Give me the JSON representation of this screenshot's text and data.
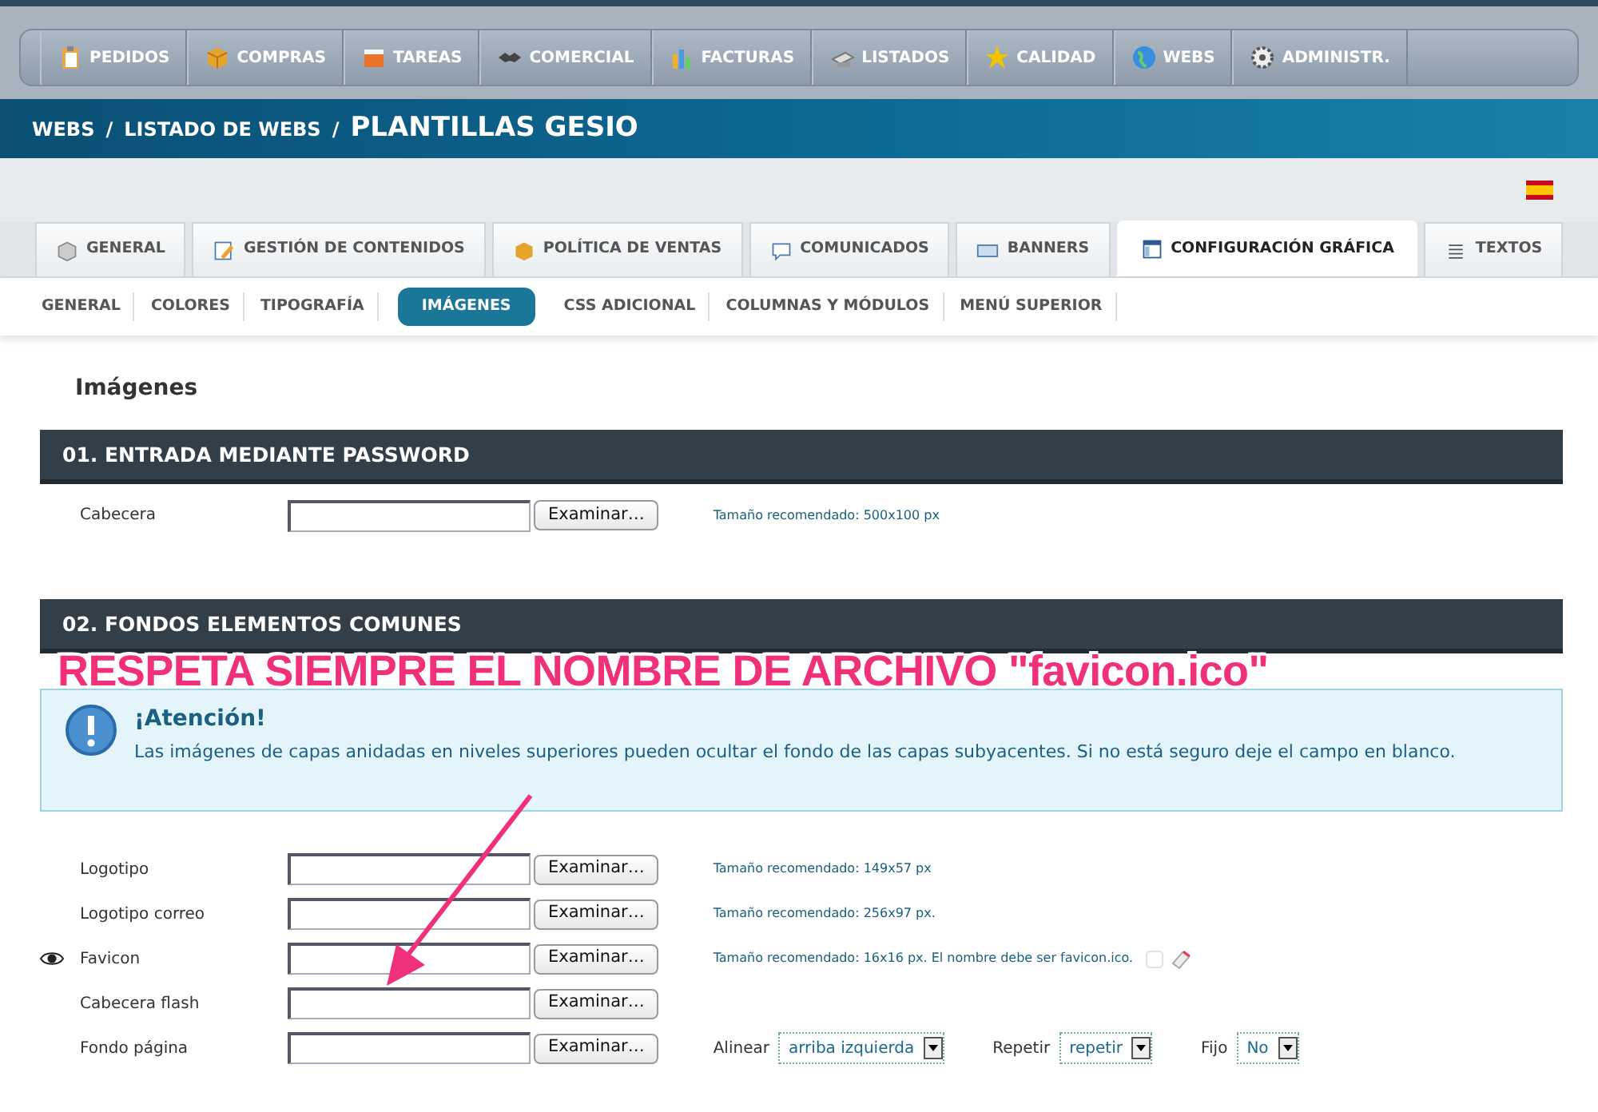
{
  "main_menu": [
    {
      "label": "PEDIDOS"
    },
    {
      "label": "COMPRAS"
    },
    {
      "label": "TAREAS"
    },
    {
      "label": "COMERCIAL"
    },
    {
      "label": "FACTURAS"
    },
    {
      "label": "LISTADOS"
    },
    {
      "label": "CALIDAD"
    },
    {
      "label": "WEBS"
    },
    {
      "label": "ADMINISTR."
    }
  ],
  "breadcrumb": [
    {
      "label": "WEBS"
    },
    {
      "label": "LISTADO DE WEBS"
    }
  ],
  "breadcrumb_separator": "/",
  "page_title": "PLANTILLAS GESIO",
  "tabs": [
    {
      "label": "GENERAL",
      "selected": false
    },
    {
      "label": "GESTIÓN DE CONTENIDOS",
      "selected": false
    },
    {
      "label": "POLÍTICA DE VENTAS",
      "selected": false
    },
    {
      "label": "COMUNICADOS",
      "selected": false
    },
    {
      "label": "BANNERS",
      "selected": false
    },
    {
      "label": "CONFIGURACIÓN GRÁFICA",
      "selected": true
    },
    {
      "label": "TEXTOS",
      "selected": false
    }
  ],
  "subtabs": [
    {
      "label": "GENERAL",
      "selected": false
    },
    {
      "label": "COLORES",
      "selected": false
    },
    {
      "label": "TIPOGRAFÍA",
      "selected": false
    },
    {
      "label": "IMÁGENES",
      "selected": true
    },
    {
      "label": "CSS ADICIONAL",
      "selected": false
    },
    {
      "label": "COLUMNAS Y MÓDULOS",
      "selected": false
    },
    {
      "label": "MENÚ SUPERIOR",
      "selected": false
    }
  ],
  "heading": "Imágenes",
  "sections": [
    {
      "title": "01. ENTRADA MEDIANTE PASSWORD",
      "fields": [
        {
          "kind": "plain",
          "label": "Cabecera",
          "browse_label": "Examinar…",
          "hint": "Tamaño recomendado: 500x100 px"
        }
      ]
    },
    {
      "title": "02. FONDOS ELEMENTOS COMUNES",
      "alert": {
        "title": "¡Atención!",
        "text": "Las imágenes de capas anidadas en niveles superiores pueden ocultar el fondo de las capas subyacentes. Si no está seguro deje el campo en blanco."
      },
      "fields": [
        {
          "kind": "plain",
          "label": "Logotipo",
          "browse_label": "Examinar…",
          "hint": "Tamaño recomendado: 149x57 px"
        },
        {
          "kind": "plain",
          "label": "Logotipo correo",
          "browse_label": "Examinar…",
          "hint": "Tamaño recomendado: 256x97 px."
        },
        {
          "kind": "preview",
          "label": "Favicon",
          "browse_label": "Examinar…",
          "hint": "Tamaño recomendado: 16x16 px. El nombre debe ser favicon.ico.",
          "checked": false
        },
        {
          "kind": "plain",
          "label": "Cabecera flash",
          "browse_label": "Examinar…"
        },
        {
          "kind": "background",
          "label": "Fondo página",
          "browse_label": "Examinar…",
          "selects": [
            {
              "label": "Alinear",
              "value": "arriba izquierda"
            },
            {
              "label": "Repetir",
              "value": "repetir"
            },
            {
              "label": "Fijo",
              "value": "No"
            }
          ]
        }
      ]
    }
  ],
  "annotation": {
    "text": "RESPETA SIEMPRE EL NOMBRE DE ARCHIVO \"favicon.ico\""
  }
}
